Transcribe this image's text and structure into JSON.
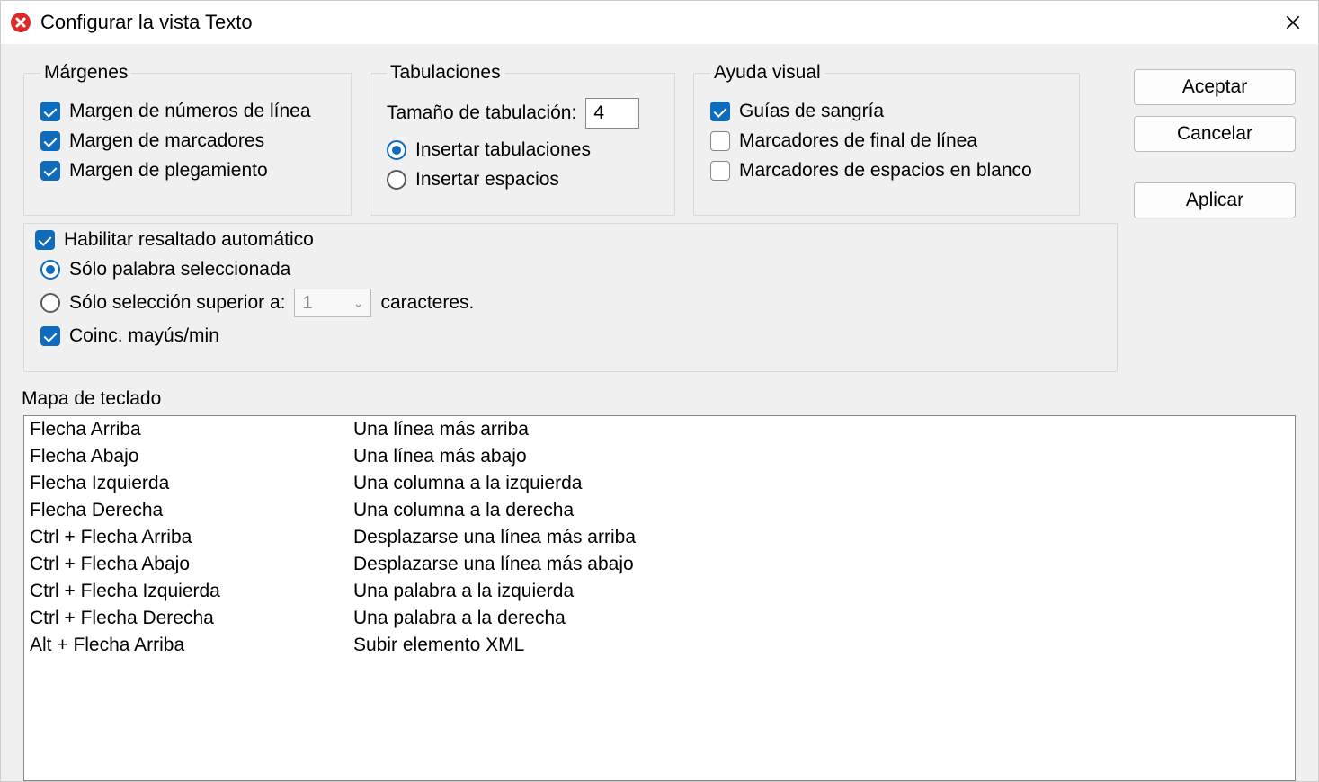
{
  "window": {
    "title": "Configurar la vista Texto"
  },
  "groups": {
    "margins": {
      "legend": "Márgenes",
      "line_numbers": "Margen de números de línea",
      "bookmarks": "Margen de marcadores",
      "folding": "Margen de plegamiento"
    },
    "tabs": {
      "legend": "Tabulaciones",
      "tab_size_label": "Tamaño de tabulación:",
      "tab_size_value": "4",
      "insert_tabs": "Insertar tabulaciones",
      "insert_spaces": "Insertar espacios"
    },
    "visual": {
      "legend": "Ayuda visual",
      "indent_guides": "Guías de sangría",
      "eol_markers": "Marcadores de final de línea",
      "whitespace_markers": "Marcadores de espacios en blanco"
    },
    "highlight": {
      "enable": "Habilitar resaltado automático",
      "selected_word": "Sólo palabra seleccionada",
      "selection_larger": "Sólo selección superior a:",
      "chars_suffix": "caracteres.",
      "chars_value": "1",
      "match_case": "Coinc. mayús/min"
    }
  },
  "buttons": {
    "ok": "Aceptar",
    "cancel": "Cancelar",
    "apply": "Aplicar"
  },
  "keymap": {
    "label": "Mapa de teclado",
    "rows": [
      {
        "key": "Flecha Arriba",
        "desc": "Una línea más arriba"
      },
      {
        "key": "Flecha Abajo",
        "desc": "Una línea más abajo"
      },
      {
        "key": "Flecha Izquierda",
        "desc": "Una columna a la izquierda"
      },
      {
        "key": "Flecha Derecha",
        "desc": "Una columna a la derecha"
      },
      {
        "key": "Ctrl + Flecha Arriba",
        "desc": "Desplazarse una línea más arriba"
      },
      {
        "key": "Ctrl + Flecha Abajo",
        "desc": "Desplazarse una línea más abajo"
      },
      {
        "key": "Ctrl + Flecha Izquierda",
        "desc": "Una palabra a la izquierda"
      },
      {
        "key": "Ctrl + Flecha Derecha",
        "desc": "Una palabra a la derecha"
      },
      {
        "key": "Alt + Flecha Arriba",
        "desc": "Subir elemento XML"
      }
    ]
  }
}
